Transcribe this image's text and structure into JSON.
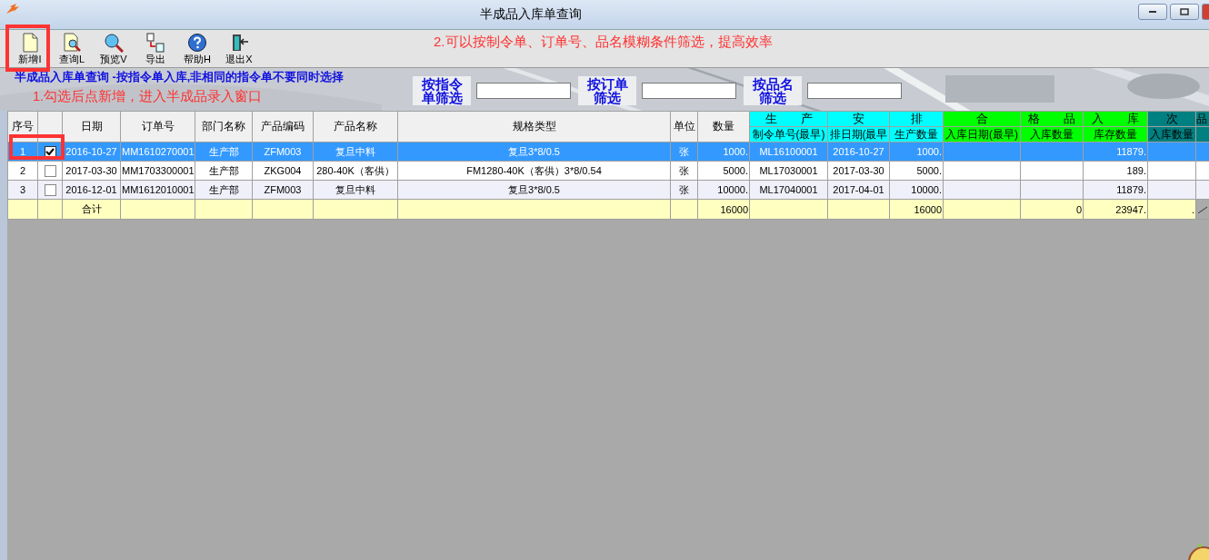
{
  "window": {
    "title": "半成品入库单查询"
  },
  "toolbar": {
    "buttons": [
      {
        "kind": "new",
        "label": "新增I"
      },
      {
        "kind": "query",
        "label": "查询L"
      },
      {
        "kind": "preview",
        "label": "预览V"
      },
      {
        "kind": "export",
        "label": "导出"
      },
      {
        "kind": "help",
        "label": "帮助H"
      },
      {
        "kind": "exit",
        "label": "退出X"
      }
    ],
    "note": "2.可以按制令单、订单号、品名模糊条件筛选，提高效率"
  },
  "banner": {
    "title": "半成品入库单查询 -按指令单入库,非相同的指令单不要同时选择",
    "note": "1.勾选后点新增，进入半成品录入窗口",
    "filters": [
      {
        "label": "按指令单筛选"
      },
      {
        "label": "按订单筛选"
      },
      {
        "label": "按品名筛选"
      }
    ]
  },
  "table": {
    "columns": [
      {
        "kind": "text",
        "label": "序号"
      },
      {
        "kind": "check"
      },
      {
        "kind": "text",
        "label": "日期"
      },
      {
        "kind": "text",
        "label": "订单号"
      },
      {
        "kind": "text",
        "label": "部门名称"
      },
      {
        "kind": "text",
        "label": "产品编码"
      },
      {
        "kind": "text",
        "label": "产品名称"
      },
      {
        "kind": "text",
        "label": "规格类型"
      },
      {
        "kind": "text",
        "label": "单位"
      },
      {
        "kind": "number",
        "label": "数量"
      },
      {
        "kind": "text",
        "label": "制令单号(最早)",
        "group": "生　　产",
        "color": "#00ffff"
      },
      {
        "kind": "text",
        "label": "排日期(最早",
        "group": "安",
        "color": "#00ffff"
      },
      {
        "kind": "number",
        "label": "生产数量",
        "group": "排",
        "color": "#00ffff"
      },
      {
        "kind": "text",
        "label": "入库日期(最早)",
        "group": "合",
        "color": "#00ff00"
      },
      {
        "kind": "number",
        "label": "入库数量",
        "group": "格　　品",
        "color": "#00ff00"
      },
      {
        "kind": "number",
        "label": "库存数量",
        "group": "入　　库",
        "color": "#00ff00"
      },
      {
        "kind": "number",
        "label": "入库数量",
        "group": "次",
        "color": "#008080"
      },
      {
        "kind": "text",
        "group": "品",
        "color": "#008080"
      }
    ],
    "rows": [
      {
        "selected": true,
        "checked": true,
        "no": "1",
        "date": "2016-10-27",
        "order_no": "MM1610270001",
        "department": "生产部",
        "product_code": "ZFM003",
        "product_name": "复旦中料",
        "spec": "复旦3*8/0.5",
        "unit": "张",
        "quantity": "1000.",
        "mo_no": "ML16100001",
        "scheduled_date": "2016-10-27",
        "production_qty": "1000.",
        "stock_qty": "11879."
      },
      {
        "selected": false,
        "checked": false,
        "no": "2",
        "date": "2017-03-30",
        "order_no": "MM1703300001",
        "department": "生产部",
        "product_code": "ZKG004",
        "product_name": "280-40K（客供）",
        "spec": "FM1280-40K（客供）3*8/0.54",
        "unit": "张",
        "quantity": "5000.",
        "mo_no": "ML17030001",
        "scheduled_date": "2017-03-30",
        "production_qty": "5000.",
        "stock_qty": "189."
      },
      {
        "selected": false,
        "checked": false,
        "no": "3",
        "date": "2016-12-01",
        "order_no": "MM1612010001",
        "department": "生产部",
        "product_code": "ZFM003",
        "product_name": "复旦中料",
        "spec": "复旦3*8/0.5",
        "unit": "张",
        "quantity": "10000.",
        "mo_no": "ML17040001",
        "scheduled_date": "2017-04-01",
        "production_qty": "10000.",
        "stock_qty": "11879."
      }
    ],
    "total": {
      "date": "合计",
      "quantity": "16000",
      "production_qty": "16000",
      "in_qty": "0",
      "stock_qty": "23947.",
      "next_in_qty": "."
    }
  }
}
